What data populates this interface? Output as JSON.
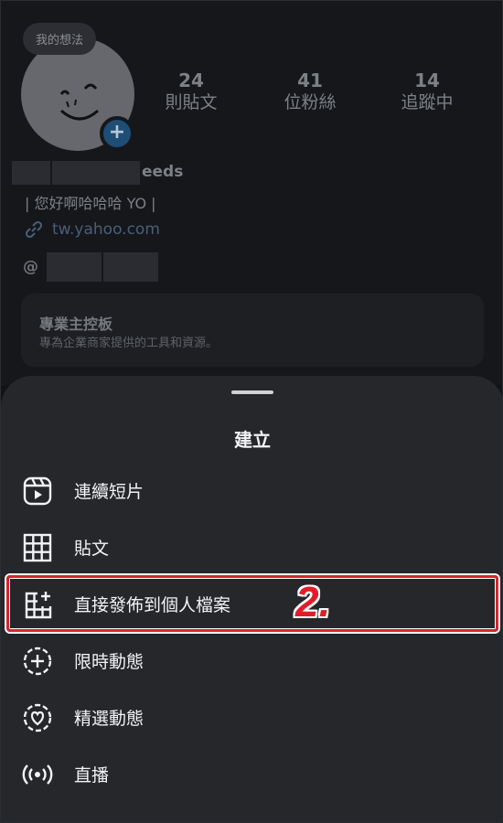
{
  "profile": {
    "note_bubble": "我的想法",
    "add_story_symbol": "+",
    "stats": [
      {
        "value": "24",
        "label": "則貼文"
      },
      {
        "value": "41",
        "label": "位粉絲"
      },
      {
        "value": "14",
        "label": "追蹤中"
      }
    ],
    "name_visible_suffix": "eeds",
    "bio": "| 您好啊哈哈哈 YO |",
    "link": "tw.yahoo.com",
    "threads_icon": "@",
    "dashboard": {
      "title": "專業主控板",
      "subtitle": "專為企業商家提供的工具和資源。"
    }
  },
  "sheet": {
    "title": "建立",
    "items": [
      {
        "label": "連續短片",
        "icon": "reels-icon"
      },
      {
        "label": "貼文",
        "icon": "grid-icon"
      },
      {
        "label": "直接發佈到個人檔案",
        "icon": "grid-plus-icon"
      },
      {
        "label": "限時動態",
        "icon": "story-add-icon"
      },
      {
        "label": "精選動態",
        "icon": "highlight-heart-icon"
      },
      {
        "label": "直播",
        "icon": "live-icon"
      }
    ]
  },
  "annotation": {
    "step_label": "2.",
    "highlight_color": "#d8242e"
  }
}
